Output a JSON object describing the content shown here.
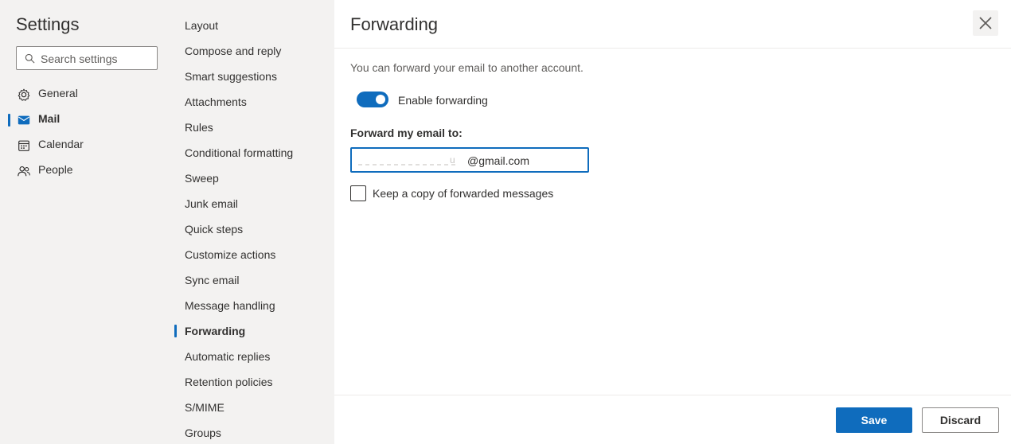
{
  "settings": {
    "title": "Settings",
    "search_placeholder": "Search settings"
  },
  "nav": {
    "items": [
      {
        "label": "General",
        "icon": "gear-icon"
      },
      {
        "label": "Mail",
        "icon": "mail-icon",
        "active": true
      },
      {
        "label": "Calendar",
        "icon": "calendar-icon"
      },
      {
        "label": "People",
        "icon": "people-icon"
      }
    ]
  },
  "mail_settings": {
    "items": [
      {
        "label": "Layout"
      },
      {
        "label": "Compose and reply"
      },
      {
        "label": "Smart suggestions"
      },
      {
        "label": "Attachments"
      },
      {
        "label": "Rules"
      },
      {
        "label": "Conditional formatting"
      },
      {
        "label": "Sweep"
      },
      {
        "label": "Junk email"
      },
      {
        "label": "Quick steps"
      },
      {
        "label": "Customize actions"
      },
      {
        "label": "Sync email"
      },
      {
        "label": "Message handling"
      },
      {
        "label": "Forwarding",
        "active": true
      },
      {
        "label": "Automatic replies"
      },
      {
        "label": "Retention policies"
      },
      {
        "label": "S/MIME"
      },
      {
        "label": "Groups"
      }
    ]
  },
  "forwarding": {
    "title": "Forwarding",
    "description": "You can forward your email to another account.",
    "enable_label": "Enable forwarding",
    "enabled": true,
    "field_label": "Forward my email to:",
    "email_visible_part": "@gmail.com",
    "email_redacted_char": "u",
    "keep_copy_label": "Keep a copy of forwarded messages",
    "keep_copy_checked": false
  },
  "footer": {
    "save_label": "Save",
    "discard_label": "Discard"
  },
  "colors": {
    "accent": "#0f6cbd",
    "sidebar_bg": "#f3f2f1"
  }
}
